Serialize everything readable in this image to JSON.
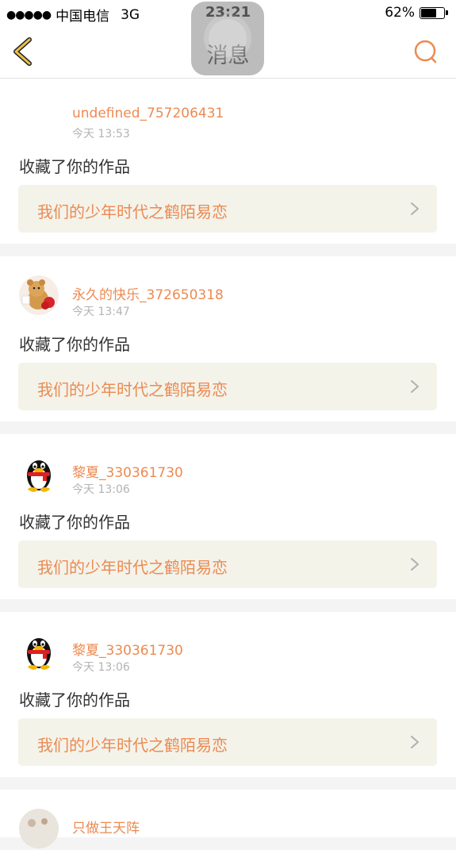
{
  "status_bar": {
    "signal_dots": "●●●●●",
    "carrier": "中国电信",
    "network": "3G",
    "time": "23:21",
    "battery_percent": "62%",
    "battery_level": 0.62
  },
  "nav": {
    "title": "消息",
    "back_icon": "chevron-left-icon",
    "search_icon": "search-icon",
    "accent_color": "#ec8a52"
  },
  "notifications": [
    {
      "username": "undefined_757206431",
      "time": "今天 13:53",
      "action": "收藏了你的作品",
      "work_title": "我们的少年时代之鹤陌易恋",
      "avatar": "none"
    },
    {
      "username": "永久的快乐_372650318",
      "time": "今天 13:47",
      "action": "收藏了你的作品",
      "work_title": "我们的少年时代之鹤陌易恋",
      "avatar": "teddy-bear"
    },
    {
      "username": "黎夏_330361730",
      "time": "今天 13:06",
      "action": "收藏了你的作品",
      "work_title": "我们的少年时代之鹤陌易恋",
      "avatar": "qq-penguin"
    },
    {
      "username": "黎夏_330361730",
      "time": "今天 13:06",
      "action": "收藏了你的作品",
      "work_title": "我们的少年时代之鹤陌易恋",
      "avatar": "qq-penguin"
    }
  ],
  "partial_notification": {
    "username": "只做王天阵"
  }
}
